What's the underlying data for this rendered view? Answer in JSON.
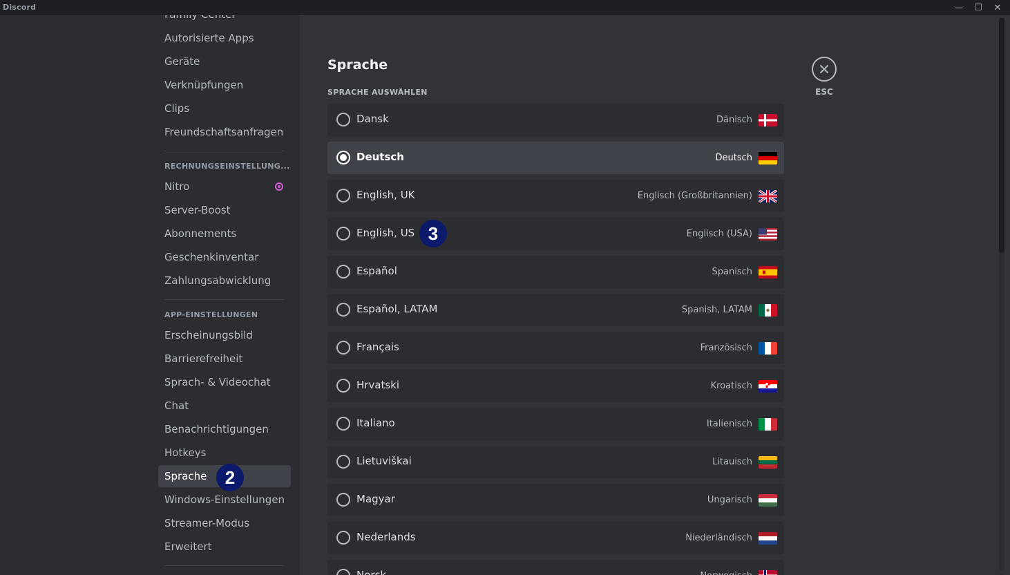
{
  "window": {
    "title": "Discord",
    "minimize": "—",
    "maximize": "☐",
    "close": "✕"
  },
  "sidebar": {
    "partial_top": "Family Center",
    "items_top": [
      "Autorisierte Apps",
      "Geräte",
      "Verknüpfungen",
      "Clips",
      "Freundschaftsanfragen"
    ],
    "billing_header": "RECHNUNGSEINSTELLUNG...",
    "billing_items": [
      "Nitro",
      "Server-Boost",
      "Abonnements",
      "Geschenkinventar",
      "Zahlungsabwicklung"
    ],
    "app_header": "APP-EINSTELLUNGEN",
    "app_items": [
      "Erscheinungsbild",
      "Barrierefreiheit",
      "Sprach- & Videochat",
      "Chat",
      "Benachrichtigungen",
      "Hotkeys",
      "Sprache",
      "Windows-Einstellungen",
      "Streamer-Modus",
      "Erweitert"
    ],
    "selected": "Sprache"
  },
  "annotations": {
    "step_sidebar": "2",
    "step_language": "3"
  },
  "main": {
    "title": "Sprache",
    "subheader": "SPRACHE AUSWÄHLEN",
    "esc_icon": "close-icon",
    "esc_label": "ESC",
    "languages": [
      {
        "name": "Dansk",
        "native": "Dänisch",
        "flag": "dk",
        "selected": false
      },
      {
        "name": "Deutsch",
        "native": "Deutsch",
        "flag": "de",
        "selected": true
      },
      {
        "name": "English, UK",
        "native": "Englisch (Großbritannien)",
        "flag": "gb",
        "selected": false
      },
      {
        "name": "English, US",
        "native": "Englisch (USA)",
        "flag": "us",
        "selected": false
      },
      {
        "name": "Español",
        "native": "Spanisch",
        "flag": "es",
        "selected": false
      },
      {
        "name": "Español, LATAM",
        "native": "Spanish, LATAM",
        "flag": "latam",
        "selected": false
      },
      {
        "name": "Français",
        "native": "Französisch",
        "flag": "fr",
        "selected": false
      },
      {
        "name": "Hrvatski",
        "native": "Kroatisch",
        "flag": "hr",
        "selected": false
      },
      {
        "name": "Italiano",
        "native": "Italienisch",
        "flag": "it",
        "selected": false
      },
      {
        "name": "Lietuviškai",
        "native": "Litauisch",
        "flag": "lt",
        "selected": false
      },
      {
        "name": "Magyar",
        "native": "Ungarisch",
        "flag": "hu",
        "selected": false
      },
      {
        "name": "Nederlands",
        "native": "Niederländisch",
        "flag": "nl",
        "selected": false
      },
      {
        "name": "Norsk",
        "native": "Norwegisch",
        "flag": "no",
        "selected": false
      }
    ]
  },
  "colors": {
    "accent_badge": "#0b1a6b",
    "nitro": "#d25cd4",
    "selected_row": "#404249"
  }
}
